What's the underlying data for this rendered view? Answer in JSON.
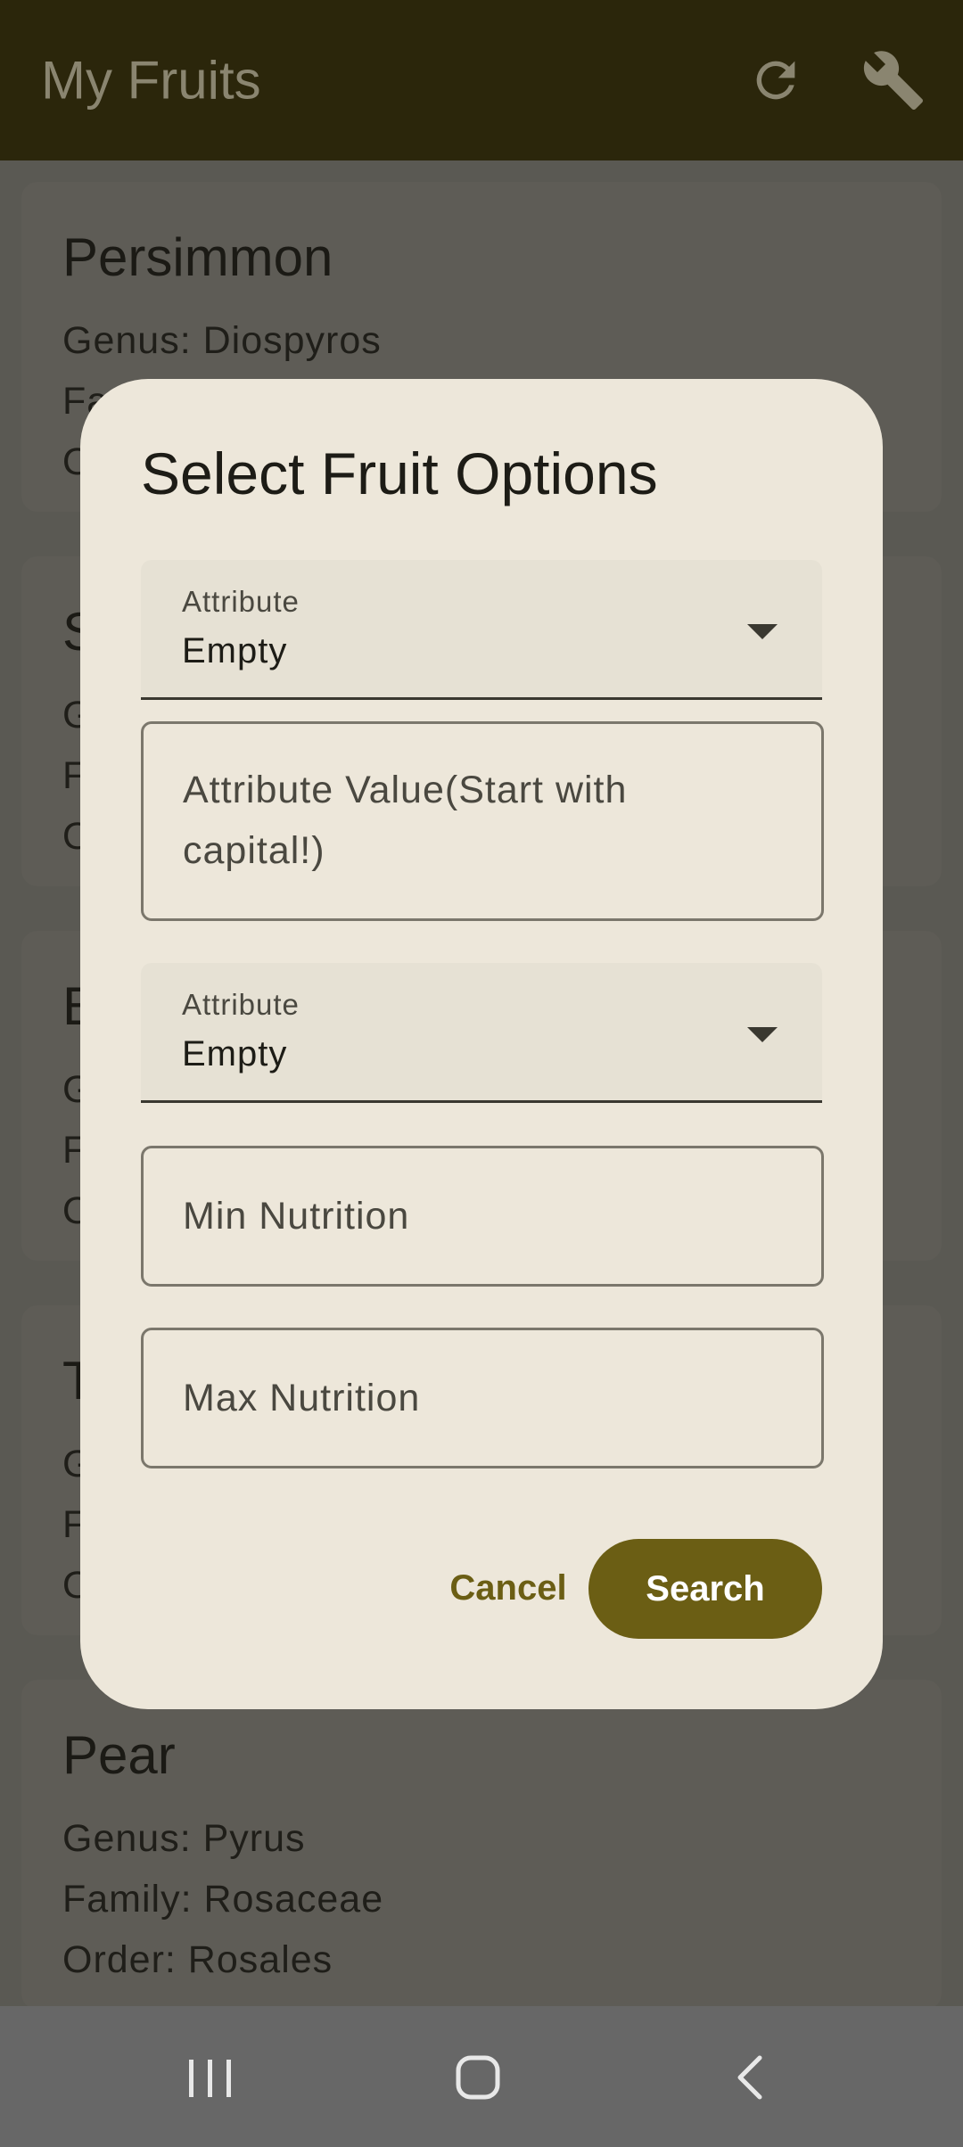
{
  "app_bar": {
    "title": "My Fruits",
    "icons": [
      "refresh-icon",
      "wrench-icon"
    ]
  },
  "fruits": [
    {
      "name": "Persimmon",
      "genus": "Genus: Diospyros",
      "family": "Family: Ebenaceae",
      "order": "O"
    },
    {
      "name": "S",
      "genus": "G",
      "family": "F",
      "order": "O"
    },
    {
      "name": "B",
      "genus": "G",
      "family": "F",
      "order": "O"
    },
    {
      "name": "T",
      "genus": "G",
      "family": "F",
      "order": "O"
    },
    {
      "name": "Pear",
      "genus": "Genus: Pyrus",
      "family": "Family: Rosaceae",
      "order": "Order: Rosales"
    }
  ],
  "dialog": {
    "title": "Select Fruit Options",
    "select1": {
      "label": "Attribute",
      "value": "Empty"
    },
    "value_field": {
      "placeholder_line1": "Attribute Value(Start with",
      "placeholder_line2": "capital!)"
    },
    "select2": {
      "label": "Attribute",
      "value": "Empty"
    },
    "min_field": {
      "placeholder": "Min Nutrition"
    },
    "max_field": {
      "placeholder": "Max Nutrition"
    },
    "cancel_label": "Cancel",
    "search_label": "Search"
  },
  "colors": {
    "app_bar": "#2b260b",
    "accent": "#6b5e14",
    "dialog_bg": "#ede7da",
    "scrim_bg": "#5a5953"
  }
}
